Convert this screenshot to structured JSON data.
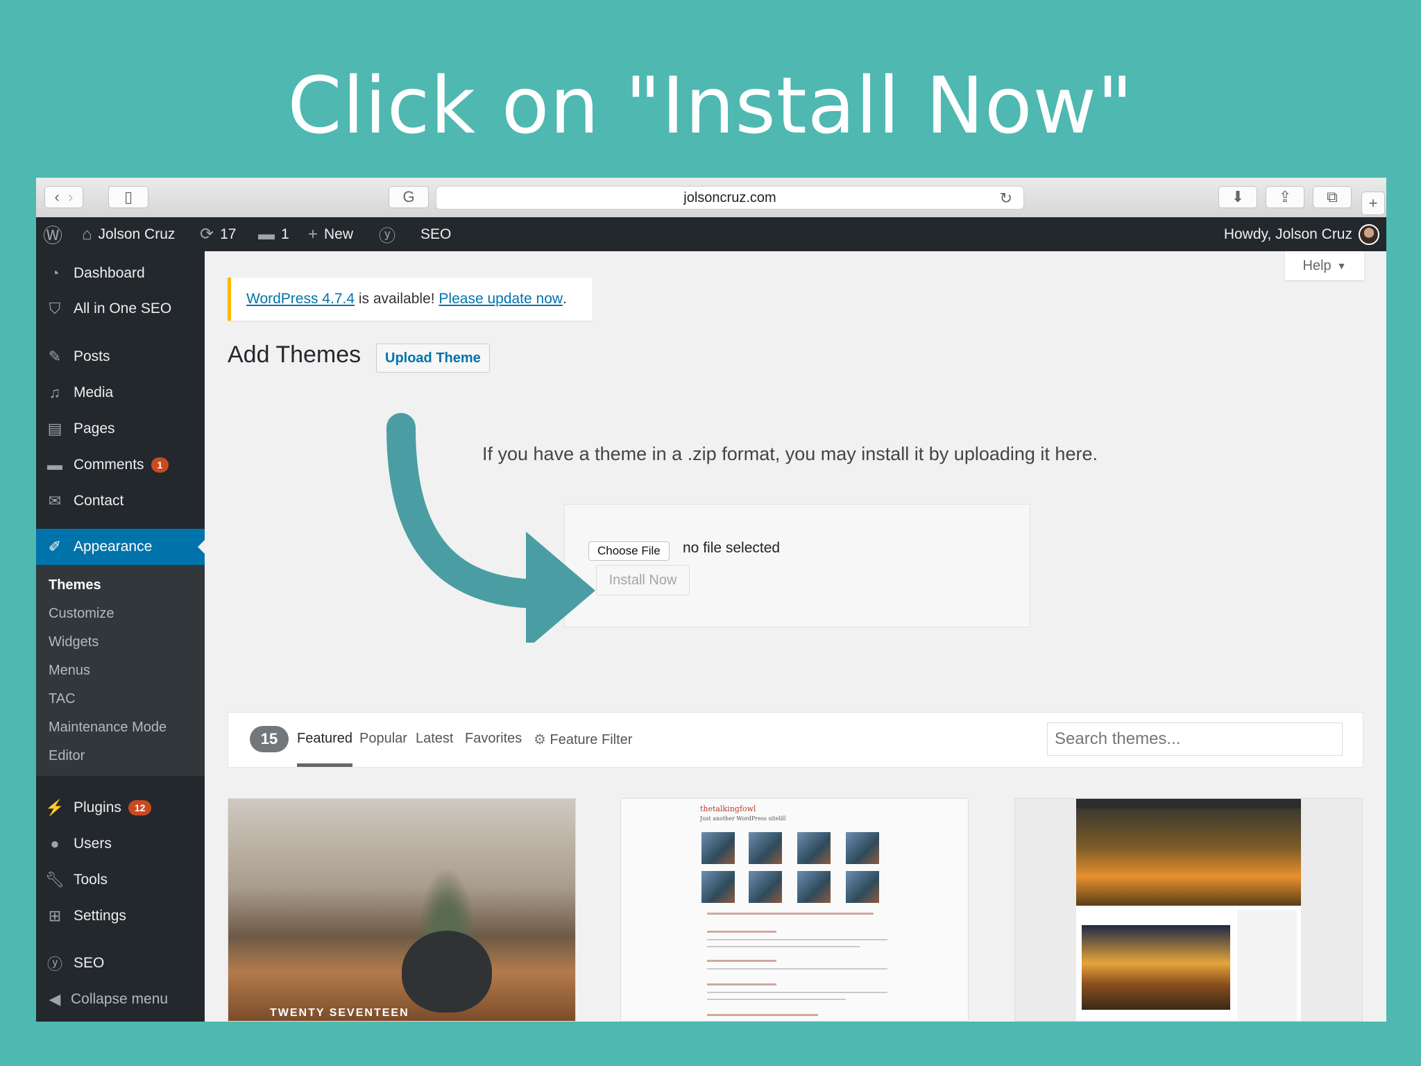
{
  "headline": "Click on \"Install Now\"",
  "browser": {
    "url": "jolsoncruz.com"
  },
  "adminbar": {
    "site_name": "Jolson Cruz",
    "updates_count": "17",
    "comments_count": "1",
    "new_label": "New",
    "seo_label": "SEO",
    "howdy": "Howdy, Jolson Cruz"
  },
  "sidebar": {
    "items": [
      {
        "label": "Dashboard",
        "icon": "dashboard-icon"
      },
      {
        "label": "All in One SEO",
        "icon": "shield-icon"
      },
      {
        "label": "Posts",
        "icon": "pin-icon"
      },
      {
        "label": "Media",
        "icon": "media-icon"
      },
      {
        "label": "Pages",
        "icon": "pages-icon"
      },
      {
        "label": "Comments",
        "icon": "comment-icon",
        "badge": "1"
      },
      {
        "label": "Contact",
        "icon": "mail-icon"
      },
      {
        "label": "Appearance",
        "icon": "brush-icon"
      },
      {
        "label": "Plugins",
        "icon": "plug-icon",
        "badge": "12"
      },
      {
        "label": "Users",
        "icon": "user-icon"
      },
      {
        "label": "Tools",
        "icon": "wrench-icon"
      },
      {
        "label": "Settings",
        "icon": "settings-icon"
      },
      {
        "label": "SEO",
        "icon": "yoast-icon"
      },
      {
        "label": "Collapse menu",
        "icon": "collapse-icon"
      }
    ],
    "submenu": [
      "Themes",
      "Customize",
      "Widgets",
      "Menus",
      "TAC",
      "Maintenance Mode",
      "Editor"
    ]
  },
  "help_label": "Help",
  "notice": {
    "link1": "WordPress 4.7.4",
    "middle": " is available! ",
    "link2": "Please update now",
    "end": "."
  },
  "page": {
    "title": "Add Themes",
    "upload_button": "Upload Theme",
    "instructions": "If you have a theme in a .zip format, you may install it by uploading it here.",
    "choose_file": "Choose File",
    "no_file": "no file selected",
    "install_now": "Install Now"
  },
  "filter": {
    "count": "15",
    "tabs": [
      "Featured",
      "Popular",
      "Latest",
      "Favorites"
    ],
    "feature_filter": "Feature Filter",
    "search_placeholder": "Search themes..."
  },
  "themes": {
    "t1_name": "TWENTY SEVENTEEN",
    "t2_title": "thetalkingfowl",
    "t2_sub": "Just another WordPress sitelill"
  },
  "colors": {
    "background": "#4eb8b1",
    "admin_dark": "#23282d",
    "active_blue": "#0073aa",
    "arrow": "#4a9ea3",
    "notice_yellow": "#ffb900"
  }
}
